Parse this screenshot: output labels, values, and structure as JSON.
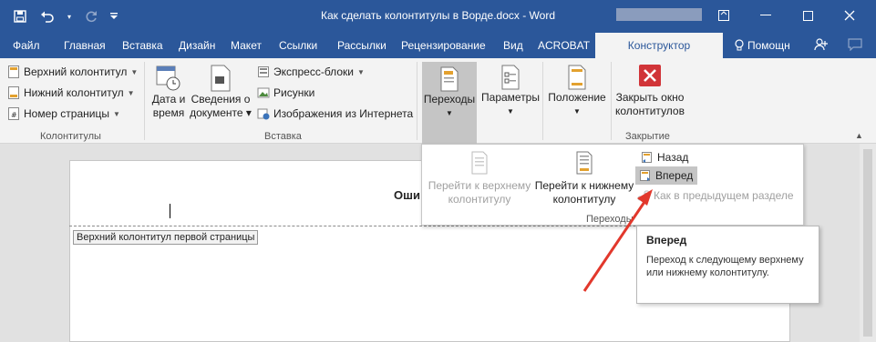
{
  "window": {
    "title": "Как сделать колонтитулы в Ворде.docx - Word"
  },
  "tabs": [
    {
      "label": "Файл"
    },
    {
      "label": "Главная"
    },
    {
      "label": "Вставка"
    },
    {
      "label": "Дизайн"
    },
    {
      "label": "Макет"
    },
    {
      "label": "Ссылки"
    },
    {
      "label": "Рассылки"
    },
    {
      "label": "Рецензирование"
    },
    {
      "label": "Вид"
    },
    {
      "label": "ACROBAT"
    },
    {
      "label": "Конструктор"
    }
  ],
  "help": {
    "label": "Помощн"
  },
  "ribbon": {
    "headers_group": {
      "label": "Колонтитулы",
      "items": [
        {
          "label": "Верхний колонтитул"
        },
        {
          "label": "Нижний колонтитул"
        },
        {
          "label": "Номер страницы"
        }
      ]
    },
    "insert_group": {
      "label": "Вставка",
      "date_time": "Дата и время",
      "doc_info": "Сведения о документе",
      "express_blocks": "Экспресс-блоки",
      "pictures": "Рисунки",
      "online_pictures": "Изображения из Интернета"
    },
    "nav": {
      "label": "Переходы"
    },
    "params": {
      "label": "Параметры"
    },
    "position": {
      "label": "Положение"
    },
    "close_group": {
      "label": "Закрытие",
      "close": "Закрыть окно колонтитулов"
    }
  },
  "dropdown": {
    "goto_header": "Перейти к верхнему колонтитулу",
    "goto_footer": "Перейти к нижнему колонтитулу",
    "back": "Назад",
    "forward": "Вперед",
    "link_previous": "Как в предыдущем разделе",
    "group_label": "Переходы"
  },
  "tooltip": {
    "title": "Вперед",
    "body": "Переход к следующему верхнему или нижнему колонтитулу."
  },
  "document": {
    "header_tag": "Верхний колонтитул первой страницы",
    "heading_partial": "Оши"
  }
}
